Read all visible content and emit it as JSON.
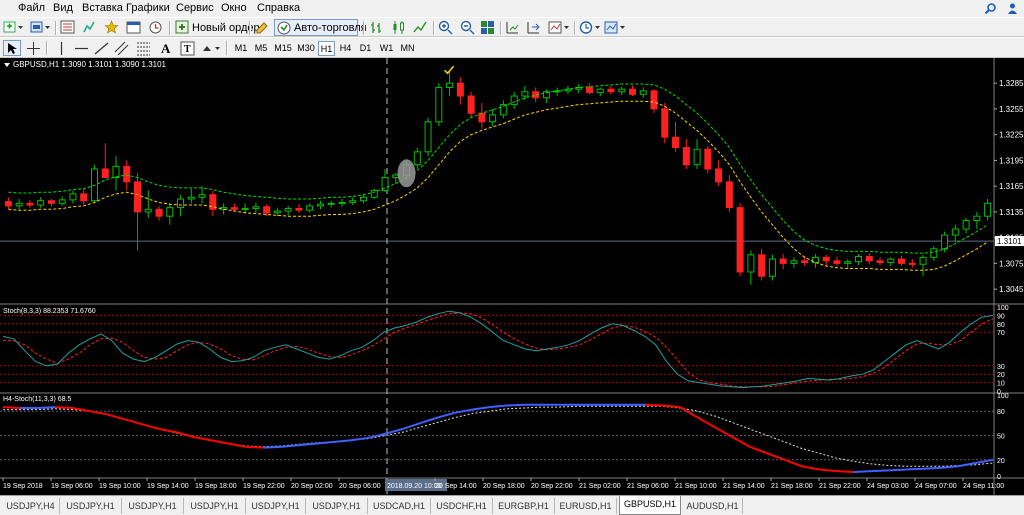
{
  "menu": [
    {
      "label": "Файл"
    },
    {
      "label": "Вид"
    },
    {
      "label": "Вставка"
    },
    {
      "label": "Графики"
    },
    {
      "label": "Сервис"
    },
    {
      "label": "Окно"
    },
    {
      "label": "Справка"
    }
  ],
  "toolbar": {
    "new_order": "Новый ордер",
    "autotrading": "Авто-торговля"
  },
  "timeframes": [
    "M1",
    "M5",
    "M15",
    "M30",
    "H1",
    "H4",
    "D1",
    "W1",
    "MN"
  ],
  "active_timeframe": "H1",
  "chart": {
    "header": "GBPUSD,H1  1.3090 1.3101 1.3090 1.3101",
    "current_price": "1.3101",
    "price_labels": [
      "1.3285",
      "1.3255",
      "1.3225",
      "1.3195",
      "1.3165",
      "1.3135",
      "1.3105",
      "1.3075",
      "1.3045"
    ],
    "stoch1_label": "Stoch(8,3,3) 88.2353 71.6760",
    "stoch1_levels": [
      "100",
      "90",
      "80",
      "70",
      "30",
      "20",
      "10",
      "0"
    ],
    "stoch2_label": "H4-Stoch(11,3,3)  68.5",
    "stoch2_levels": [
      "100",
      "80",
      "50",
      "20",
      "0"
    ],
    "time_labels": [
      "19 Sep 2018",
      "19 Sep 06:00",
      "19 Sep 10:00",
      "19 Sep 14:00",
      "19 Sep 18:00",
      "19 Sep 22:00",
      "20 Sep 02:00",
      "20 Sep 06:00",
      "2018.09.20 10:00",
      "20 Sep 14:00",
      "20 Sep 18:00",
      "20 Sep 22:00",
      "21 Sep 02:00",
      "21 Sep 06:00",
      "21 Sep 10:00",
      "21 Sep 14:00",
      "21 Sep 18:00",
      "21 Sep 22:00",
      "24 Sep 03:00",
      "24 Sep 07:00",
      "24 Sep 11:00"
    ],
    "colors": {
      "bull": "#00c000",
      "bear": "#ff2020",
      "bg": "#000000",
      "grid": "#404040",
      "level": "#b00000",
      "stoch_main": "#20a0a0",
      "stoch_signal": "#ff2020",
      "h4_up": "#4060ff",
      "h4_down": "#ff0000"
    }
  },
  "chart_data": {
    "type": "candlestick",
    "symbol": "GBPUSD",
    "timeframe": "H1",
    "ylim": [
      1.303,
      1.3305
    ],
    "current": 1.3101,
    "candles": [
      [
        1.3147,
        1.3152,
        1.3138,
        1.3142
      ],
      [
        1.3142,
        1.315,
        1.3138,
        1.3145
      ],
      [
        1.3145,
        1.3149,
        1.314,
        1.3143
      ],
      [
        1.3143,
        1.3152,
        1.314,
        1.3148
      ],
      [
        1.3148,
        1.315,
        1.3141,
        1.3145
      ],
      [
        1.3145,
        1.3153,
        1.3142,
        1.3149
      ],
      [
        1.3149,
        1.316,
        1.3145,
        1.3156
      ],
      [
        1.3156,
        1.3162,
        1.3144,
        1.3148
      ],
      [
        1.3148,
        1.319,
        1.3146,
        1.3185
      ],
      [
        1.3185,
        1.3215,
        1.318,
        1.3175
      ],
      [
        1.3175,
        1.32,
        1.316,
        1.3188
      ],
      [
        1.3188,
        1.3195,
        1.316,
        1.317
      ],
      [
        1.317,
        1.318,
        1.309,
        1.3135
      ],
      [
        1.3135,
        1.316,
        1.3128,
        1.3138
      ],
      [
        1.3138,
        1.3142,
        1.3125,
        1.313
      ],
      [
        1.313,
        1.3145,
        1.312,
        1.314
      ],
      [
        1.314,
        1.3155,
        1.313,
        1.315
      ],
      [
        1.315,
        1.3162,
        1.3145,
        1.3152
      ],
      [
        1.3152,
        1.3165,
        1.3145,
        1.3155
      ],
      [
        1.3155,
        1.316,
        1.313,
        1.3138
      ],
      [
        1.3138,
        1.3145,
        1.3132,
        1.314
      ],
      [
        1.314,
        1.3145,
        1.3135,
        1.3138
      ],
      [
        1.3138,
        1.3145,
        1.3133,
        1.3139
      ],
      [
        1.3139,
        1.3146,
        1.3134,
        1.3141
      ],
      [
        1.3141,
        1.3144,
        1.313,
        1.3134
      ],
      [
        1.3134,
        1.314,
        1.313,
        1.3136
      ],
      [
        1.3136,
        1.3142,
        1.3131,
        1.3139
      ],
      [
        1.3139,
        1.3144,
        1.3134,
        1.3137
      ],
      [
        1.3137,
        1.3145,
        1.3134,
        1.3142
      ],
      [
        1.3142,
        1.3148,
        1.3138,
        1.3144
      ],
      [
        1.3144,
        1.3148,
        1.314,
        1.3145
      ],
      [
        1.3145,
        1.315,
        1.3141,
        1.3146
      ],
      [
        1.3146,
        1.3152,
        1.3143,
        1.3148
      ],
      [
        1.3148,
        1.3155,
        1.3145,
        1.3152
      ],
      [
        1.3152,
        1.3162,
        1.315,
        1.316
      ],
      [
        1.316,
        1.3185,
        1.3158,
        1.3175
      ],
      [
        1.3175,
        1.318,
        1.3168,
        1.3178
      ],
      [
        1.3178,
        1.3195,
        1.3172,
        1.319
      ],
      [
        1.319,
        1.321,
        1.3185,
        1.3205
      ],
      [
        1.3205,
        1.3245,
        1.32,
        1.324
      ],
      [
        1.324,
        1.3285,
        1.3235,
        1.328
      ],
      [
        1.328,
        1.3298,
        1.327,
        1.3285
      ],
      [
        1.3285,
        1.3292,
        1.326,
        1.327
      ],
      [
        1.327,
        1.3275,
        1.3245,
        1.325
      ],
      [
        1.325,
        1.3262,
        1.3232,
        1.324
      ],
      [
        1.324,
        1.3255,
        1.3235,
        1.3248
      ],
      [
        1.3248,
        1.3265,
        1.3244,
        1.326
      ],
      [
        1.326,
        1.3275,
        1.3255,
        1.327
      ],
      [
        1.327,
        1.3282,
        1.3265,
        1.3275
      ],
      [
        1.3275,
        1.328,
        1.3263,
        1.3268
      ],
      [
        1.3268,
        1.3278,
        1.3262,
        1.3275
      ],
      [
        1.3275,
        1.328,
        1.327,
        1.3276
      ],
      [
        1.3276,
        1.3282,
        1.3272,
        1.3278
      ],
      [
        1.3278,
        1.3284,
        1.3273,
        1.328
      ],
      [
        1.328,
        1.3285,
        1.3272,
        1.3274
      ],
      [
        1.3274,
        1.328,
        1.327,
        1.3278
      ],
      [
        1.3278,
        1.3282,
        1.3272,
        1.3275
      ],
      [
        1.3275,
        1.3281,
        1.3271,
        1.3278
      ],
      [
        1.3278,
        1.3282,
        1.327,
        1.3272
      ],
      [
        1.3272,
        1.328,
        1.3268,
        1.3276
      ],
      [
        1.3276,
        1.3278,
        1.325,
        1.3255
      ],
      [
        1.3255,
        1.3262,
        1.3215,
        1.3222
      ],
      [
        1.3222,
        1.324,
        1.3205,
        1.321
      ],
      [
        1.321,
        1.322,
        1.3185,
        1.319
      ],
      [
        1.319,
        1.322,
        1.3185,
        1.3208
      ],
      [
        1.3208,
        1.3212,
        1.318,
        1.3185
      ],
      [
        1.3185,
        1.3195,
        1.3165,
        1.317
      ],
      [
        1.317,
        1.3178,
        1.3135,
        1.314
      ],
      [
        1.314,
        1.3145,
        1.306,
        1.3065
      ],
      [
        1.3065,
        1.309,
        1.305,
        1.3085
      ],
      [
        1.3085,
        1.3092,
        1.3055,
        1.306
      ],
      [
        1.306,
        1.3085,
        1.3055,
        1.308
      ],
      [
        1.308,
        1.3086,
        1.3068,
        1.3075
      ],
      [
        1.3075,
        1.3082,
        1.307,
        1.3078
      ],
      [
        1.3078,
        1.3084,
        1.3072,
        1.3076
      ],
      [
        1.3076,
        1.3086,
        1.307,
        1.3082
      ],
      [
        1.3082,
        1.3085,
        1.3072,
        1.3078
      ],
      [
        1.3078,
        1.3083,
        1.3072,
        1.3075
      ],
      [
        1.3075,
        1.308,
        1.307,
        1.3077
      ],
      [
        1.3077,
        1.3086,
        1.3073,
        1.3083
      ],
      [
        1.3083,
        1.3087,
        1.3074,
        1.3078
      ],
      [
        1.3078,
        1.3082,
        1.3073,
        1.3076
      ],
      [
        1.3076,
        1.3082,
        1.3072,
        1.308
      ],
      [
        1.308,
        1.3084,
        1.3072,
        1.3075
      ],
      [
        1.3075,
        1.308,
        1.307,
        1.3074
      ],
      [
        1.3074,
        1.3085,
        1.306,
        1.3082
      ],
      [
        1.3082,
        1.3095,
        1.3078,
        1.3092
      ],
      [
        1.3092,
        1.3112,
        1.3088,
        1.3108
      ],
      [
        1.3108,
        1.312,
        1.31,
        1.3115
      ],
      [
        1.3115,
        1.3128,
        1.311,
        1.3125
      ],
      [
        1.3125,
        1.3135,
        1.3115,
        1.313
      ],
      [
        1.313,
        1.315,
        1.3125,
        1.3145
      ]
    ],
    "envelope_upper": [
      1.3158,
      1.3157,
      1.3157,
      1.3158,
      1.3158,
      1.3159,
      1.3161,
      1.3162,
      1.3166,
      1.3172,
      1.3176,
      1.3178,
      1.3175,
      1.317,
      1.3166,
      1.3164,
      1.3163,
      1.3163,
      1.3163,
      1.3161,
      1.3158,
      1.3156,
      1.3154,
      1.3153,
      1.3152,
      1.3151,
      1.315,
      1.315,
      1.315,
      1.3151,
      1.3152,
      1.3152,
      1.3153,
      1.3155,
      1.3158,
      1.3163,
      1.3168,
      1.3175,
      1.3183,
      1.3195,
      1.321,
      1.3225,
      1.3237,
      1.3245,
      1.325,
      1.3254,
      1.3258,
      1.3263,
      1.3268,
      1.3271,
      1.3274,
      1.3276,
      1.3278,
      1.328,
      1.3281,
      1.3282,
      1.3283,
      1.3284,
      1.3284,
      1.3284,
      1.3283,
      1.3278,
      1.327,
      1.326,
      1.325,
      1.3238,
      1.3225,
      1.321,
      1.319,
      1.3172,
      1.3155,
      1.314,
      1.3125,
      1.3112,
      1.3102,
      1.3096,
      1.3092,
      1.309,
      1.3089,
      1.3089,
      1.3089,
      1.3088,
      1.3088,
      1.3088,
      1.3087,
      1.3087,
      1.3088,
      1.3092,
      1.3098,
      1.3105,
      1.3112,
      1.312
    ],
    "envelope_lower": [
      1.3138,
      1.3137,
      1.3137,
      1.3138,
      1.3138,
      1.3139,
      1.3141,
      1.3142,
      1.3146,
      1.3152,
      1.3156,
      1.3158,
      1.3155,
      1.315,
      1.3146,
      1.3144,
      1.3143,
      1.3143,
      1.3143,
      1.3141,
      1.3138,
      1.3136,
      1.3134,
      1.3133,
      1.3132,
      1.3131,
      1.313,
      1.313,
      1.313,
      1.3131,
      1.3132,
      1.3132,
      1.3133,
      1.3135,
      1.3138,
      1.3143,
      1.3148,
      1.3155,
      1.3163,
      1.3175,
      1.319,
      1.3205,
      1.3217,
      1.3225,
      1.323,
      1.3234,
      1.3238,
      1.3243,
      1.3248,
      1.3251,
      1.3254,
      1.3256,
      1.3258,
      1.326,
      1.3261,
      1.3262,
      1.3263,
      1.3264,
      1.3264,
      1.3264,
      1.3263,
      1.3258,
      1.325,
      1.324,
      1.323,
      1.3218,
      1.3205,
      1.319,
      1.317,
      1.3152,
      1.3135,
      1.312,
      1.3105,
      1.3092,
      1.3082,
      1.3076,
      1.3072,
      1.307,
      1.3069,
      1.3069,
      1.3069,
      1.3068,
      1.3068,
      1.3068,
      1.3067,
      1.3067,
      1.3068,
      1.3072,
      1.3078,
      1.3085,
      1.3092,
      1.31
    ],
    "stoch_main": [
      65,
      62,
      48,
      35,
      30,
      32,
      45,
      55,
      62,
      68,
      60,
      45,
      38,
      35,
      40,
      48,
      56,
      60,
      58,
      50,
      40,
      35,
      36,
      40,
      48,
      52,
      55,
      50,
      45,
      40,
      38,
      42,
      48,
      52,
      60,
      70,
      75,
      78,
      82,
      88,
      92,
      95,
      93,
      88,
      80,
      70,
      60,
      55,
      50,
      48,
      50,
      52,
      55,
      60,
      68,
      75,
      80,
      78,
      72,
      65,
      55,
      35,
      20,
      12,
      10,
      8,
      6,
      5,
      4,
      5,
      6,
      8,
      10,
      12,
      15,
      14,
      13,
      15,
      18,
      20,
      25,
      35,
      45,
      55,
      60,
      55,
      50,
      58,
      70,
      80,
      88,
      90
    ],
    "stoch_signal": [
      60,
      60,
      55,
      45,
      38,
      33,
      38,
      45,
      55,
      62,
      63,
      58,
      48,
      40,
      38,
      40,
      48,
      55,
      58,
      56,
      50,
      42,
      38,
      37,
      42,
      48,
      52,
      53,
      50,
      45,
      41,
      40,
      43,
      48,
      54,
      62,
      70,
      75,
      79,
      84,
      88,
      92,
      93,
      92,
      87,
      79,
      70,
      62,
      56,
      51,
      49,
      50,
      52,
      55,
      61,
      68,
      75,
      78,
      76,
      71,
      64,
      52,
      37,
      22,
      13,
      10,
      8,
      6,
      5,
      5,
      5,
      6,
      8,
      10,
      12,
      13,
      14,
      14,
      15,
      17,
      21,
      28,
      38,
      48,
      56,
      57,
      55,
      55,
      60,
      70,
      80,
      86
    ],
    "h4_main": [
      85,
      84,
      84,
      85,
      84,
      80,
      76,
      70,
      64,
      58,
      54,
      48,
      44,
      40,
      36,
      35,
      36,
      38,
      40,
      42,
      44,
      47,
      52,
      58,
      65,
      72,
      78,
      82,
      85,
      87,
      88,
      88,
      88,
      88,
      88,
      88,
      88,
      88,
      87,
      85,
      72,
      60,
      48,
      36,
      28,
      20,
      12,
      8,
      6,
      5,
      6,
      7,
      8,
      9,
      10,
      12,
      16,
      20
    ],
    "h4_signal": [
      82,
      82,
      82,
      83,
      82,
      80,
      76,
      70,
      64,
      58,
      53,
      48,
      44,
      40,
      37,
      36,
      37,
      39,
      41,
      42,
      44,
      46,
      50,
      54,
      60,
      66,
      72,
      77,
      80,
      83,
      84,
      85,
      85,
      86,
      86,
      86,
      86,
      86,
      86,
      84,
      80,
      74,
      66,
      58,
      50,
      42,
      34,
      28,
      22,
      18,
      15,
      13,
      12,
      12,
      12,
      13,
      14,
      16
    ]
  },
  "tabs": [
    "USDJPY,H4",
    "USDJPY,H1",
    "USDJPY,H1",
    "USDJPY,H1",
    "USDJPY,H1",
    "USDJPY,H1",
    "USDCAD,H1",
    "USDCHF,H1",
    "EURGBP,H1",
    "EURUSD,H1",
    "GBPUSD,H1",
    "AUDUSD,H1"
  ],
  "active_tab": "GBPUSD,H1"
}
